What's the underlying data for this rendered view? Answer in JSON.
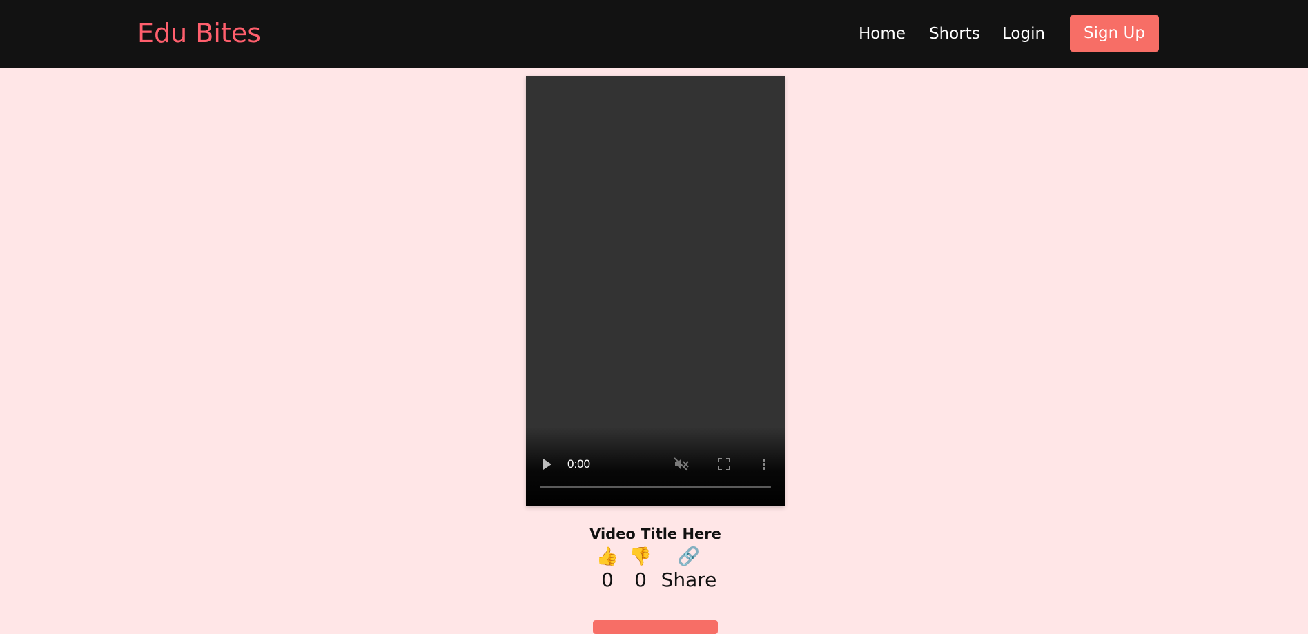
{
  "header": {
    "brand": "Edu Bites",
    "nav": {
      "home": "Home",
      "shorts": "Shorts",
      "login": "Login",
      "signup": "Sign Up"
    }
  },
  "video": {
    "current_time": "0:00",
    "title": "Video Title Here",
    "progress": 0
  },
  "actions": {
    "like_icon": "👍",
    "like_count": "0",
    "dislike_icon": "👎",
    "dislike_count": "0",
    "share_icon": "🔗",
    "share_label": "Share"
  },
  "colors": {
    "page_bg": "#ffe6e7",
    "navbar_bg": "#121212",
    "brand": "#ff5f6d",
    "accent_button": "#f76e66"
  }
}
